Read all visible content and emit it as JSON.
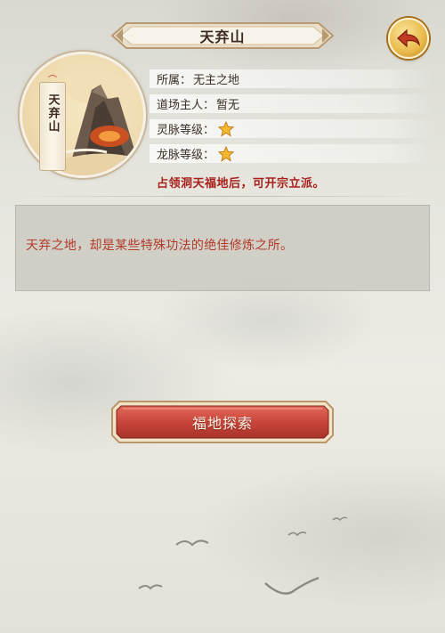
{
  "header": {
    "title": "天弃山"
  },
  "medallion": {
    "scroll_label": "天弃山",
    "tag_glyph": "⌒"
  },
  "info": {
    "rows": [
      {
        "label": "所属：",
        "value": "无主之地"
      },
      {
        "label": "道场主人：",
        "value": "暂无"
      },
      {
        "label": "灵脉等级：",
        "stars": 1,
        "icon": "star-icon"
      },
      {
        "label": "龙脉等级：",
        "stars": 1,
        "icon": "star-icon"
      }
    ],
    "notice": "占领洞天福地后，可开宗立派。"
  },
  "description": {
    "text": "天弃之地，却是某些特殊功法的绝佳修炼之所。"
  },
  "actions": {
    "explore_label": "福地探索"
  },
  "colors": {
    "notice_red": "#a8201c",
    "desc_red": "#b23b2a",
    "button_red": "#c8453a",
    "gold": "#e9b94a"
  }
}
